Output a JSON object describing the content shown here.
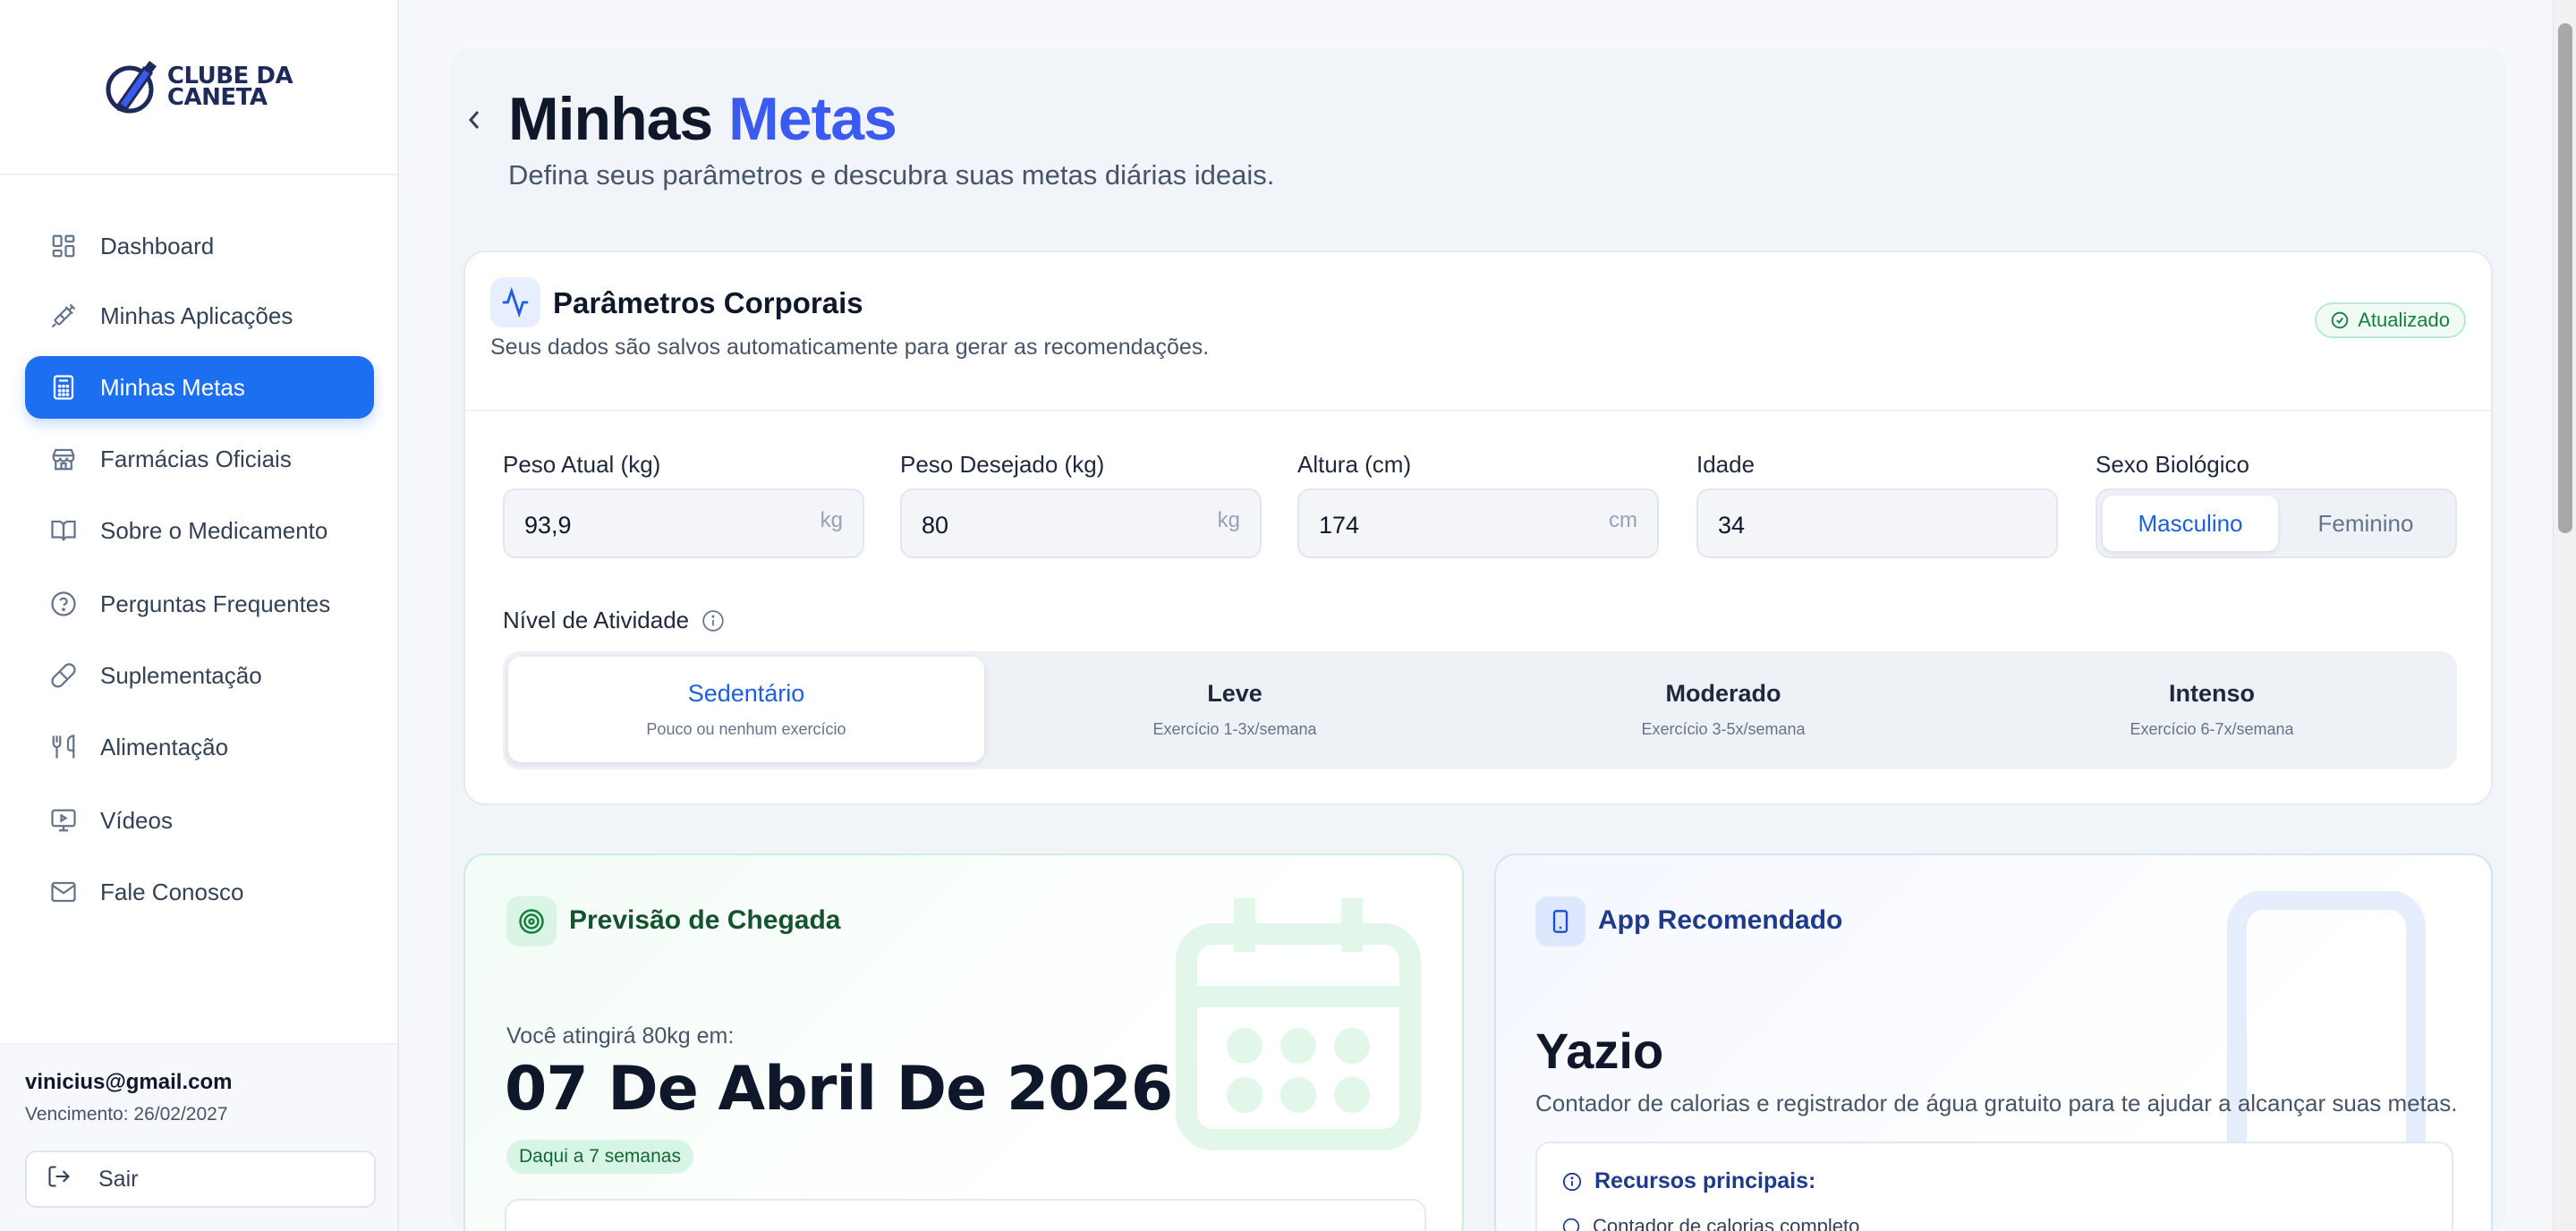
{
  "brand": {
    "line1": "CLUBE DA",
    "line2": "CANETA"
  },
  "sidebar": {
    "items": [
      {
        "label": "Dashboard",
        "icon": "dashboard-icon"
      },
      {
        "label": "Minhas Aplicações",
        "icon": "syringe-icon"
      },
      {
        "label": "Minhas Metas",
        "icon": "calculator-icon",
        "active": true
      },
      {
        "label": "Farmácias Oficiais",
        "icon": "store-icon"
      },
      {
        "label": "Sobre o Medicamento",
        "icon": "book-open-icon"
      },
      {
        "label": "Perguntas Frequentes",
        "icon": "help-circle-icon"
      },
      {
        "label": "Suplementação",
        "icon": "pill-icon"
      },
      {
        "label": "Alimentação",
        "icon": "utensils-icon"
      },
      {
        "label": "Vídeos",
        "icon": "monitor-play-icon"
      },
      {
        "label": "Fale Conosco",
        "icon": "mail-icon"
      }
    ],
    "user": {
      "email": "vinicius@gmail.com",
      "expiry": "Vencimento: 26/02/2027"
    },
    "logout_label": "Sair"
  },
  "header": {
    "title_part1": "Minhas",
    "title_part2": "Metas",
    "subtitle": "Defina seus parâmetros e descubra suas metas diárias ideais."
  },
  "params": {
    "title": "Parâmetros Corporais",
    "description": "Seus dados são salvos automaticamente para gerar as recomendações.",
    "status": "Atualizado",
    "fields": {
      "peso_atual": {
        "label": "Peso Atual (kg)",
        "value": "93,9",
        "unit": "kg"
      },
      "peso_desejado": {
        "label": "Peso Desejado (kg)",
        "value": "80",
        "unit": "kg"
      },
      "altura": {
        "label": "Altura (cm)",
        "value": "174",
        "unit": "cm"
      },
      "idade": {
        "label": "Idade",
        "value": "34"
      }
    },
    "sex": {
      "label": "Sexo Biológico",
      "options": [
        "Masculino",
        "Feminino"
      ],
      "selected": "Masculino"
    },
    "activity": {
      "label": "Nível de Atividade",
      "options": [
        {
          "title": "Sedentário",
          "subtitle": "Pouco ou nenhum exercício"
        },
        {
          "title": "Leve",
          "subtitle": "Exercício 1-3x/semana"
        },
        {
          "title": "Moderado",
          "subtitle": "Exercício 3-5x/semana"
        },
        {
          "title": "Intenso",
          "subtitle": "Exercício 6-7x/semana"
        }
      ],
      "selected": "Sedentário"
    }
  },
  "arrival": {
    "title": "Previsão de Chegada",
    "lead": "Você atingirá 80kg em:",
    "date": "07 De Abril De 2026",
    "eta": "Daqui a 7 semanas"
  },
  "app": {
    "title": "App Recomendado",
    "name": "Yazio",
    "description": "Contador de calorias e registrador de água gratuito para te ajudar a alcançar suas metas.",
    "resources_title": "Recursos principais:",
    "resource_1": "Contador de calorias completo"
  },
  "colors": {
    "primary": "#1d6ff2",
    "title_accent": "#3b5bf0",
    "success": "#15803d"
  }
}
